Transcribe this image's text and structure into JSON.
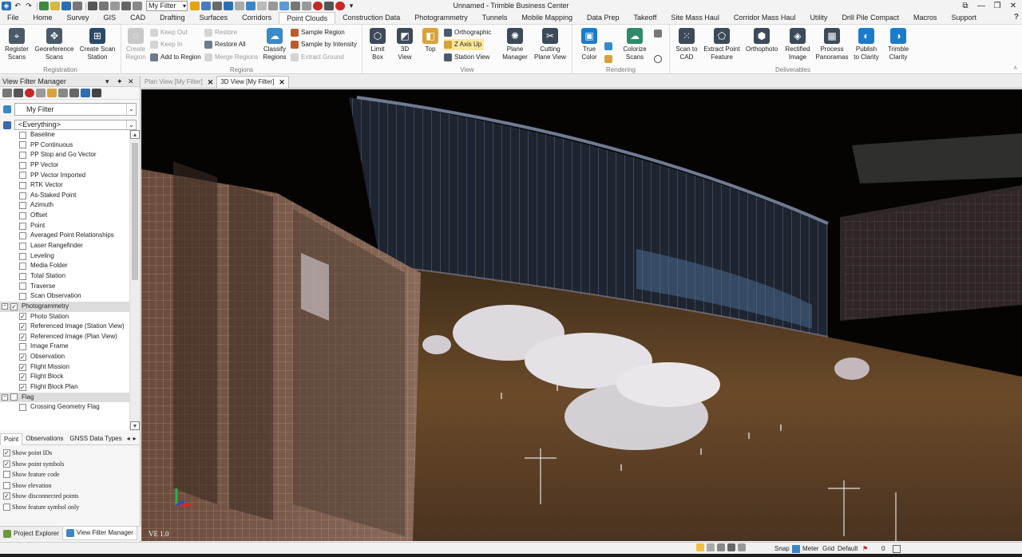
{
  "app": {
    "title": "Unnamed - Trimble Business Center",
    "filter_combo": "My Filter"
  },
  "window_controls": {
    "minimize": "—",
    "restore": "❐",
    "close": "✕",
    "pin": "⧉",
    "help": "?"
  },
  "menu": {
    "tabs": [
      "File",
      "Home",
      "Survey",
      "GIS",
      "CAD",
      "Drafting",
      "Surfaces",
      "Corridors",
      "Point Clouds",
      "Construction Data",
      "Photogrammetry",
      "Tunnels",
      "Mobile Mapping",
      "Data Prep",
      "Takeoff",
      "Site Mass Haul",
      "Corridor Mass Haul",
      "Utility",
      "Drill Pile Compact",
      "Macros",
      "Support"
    ],
    "active": "Point Clouds"
  },
  "ribbon": {
    "registration": {
      "label": "Registration",
      "register": "Register\nScans",
      "georeference": "Georeference\nScans",
      "create_scan_station": "Create Scan\nStation"
    },
    "regions": {
      "label": "Regions",
      "create_region": "Create\nRegion",
      "keep_out": "Keep Out",
      "keep_in": "Keep In",
      "add_to_region": "Add to Region",
      "restore": "Restore",
      "restore_all": "Restore All",
      "merge_regions": "Merge Regions",
      "classify_regions": "Classify\nRegions",
      "sample_region": "Sample Region",
      "sample_by_intensity": "Sample by Intensity",
      "extract_ground": "Extract Ground"
    },
    "view": {
      "label": "View",
      "limit_box": "Limit\nBox",
      "view_3d": "3D\nView",
      "top": "Top",
      "orthographic": "Orthographic",
      "z_axis_up": "Z Axis Up",
      "station_view": "Station View",
      "plane_manager": "Plane\nManager",
      "cutting_plane_view": "Cutting\nPlane View"
    },
    "rendering": {
      "label": "Rendering",
      "true_color": "True\nColor",
      "colorize_scans": "Colorize\nScans"
    },
    "deliverables": {
      "label": "Deliverables",
      "scan_to_cad": "Scan to\nCAD",
      "extract_point_feature": "Extract Point\nFeature",
      "orthophoto": "Orthophoto",
      "rectified_image": "Rectified\nImage",
      "process_panoramas": "Process\nPanoramas",
      "publish_to_clarity": "Publish\nto Clarity",
      "trimble_clarity": "Trimble\nClarity"
    }
  },
  "panel": {
    "title": "View Filter Manager",
    "pin_glyph": "▾ ✦ ✕",
    "filter_value": "My Filter",
    "scope_value": "<Everything>",
    "tree": [
      {
        "label": "Baseline",
        "checked": false,
        "type": "item"
      },
      {
        "label": "PP Continuous",
        "checked": false,
        "type": "item"
      },
      {
        "label": "PP Stop and Go Vector",
        "checked": false,
        "type": "item"
      },
      {
        "label": "PP Vector",
        "checked": false,
        "type": "item"
      },
      {
        "label": "PP Vector Imported",
        "checked": false,
        "type": "item"
      },
      {
        "label": "RTK Vector",
        "checked": false,
        "type": "item"
      },
      {
        "label": "As-Staked Point",
        "checked": false,
        "type": "item"
      },
      {
        "label": "Azimuth",
        "checked": false,
        "type": "item"
      },
      {
        "label": "Offset",
        "checked": false,
        "type": "item"
      },
      {
        "label": "Point",
        "checked": false,
        "type": "item"
      },
      {
        "label": "Averaged Point Relationships",
        "checked": false,
        "type": "item"
      },
      {
        "label": "Laser Rangefinder",
        "checked": false,
        "type": "item"
      },
      {
        "label": "Leveling",
        "checked": false,
        "type": "item"
      },
      {
        "label": "Media Folder",
        "checked": false,
        "type": "item"
      },
      {
        "label": "Total Station",
        "checked": false,
        "type": "item"
      },
      {
        "label": "Traverse",
        "checked": false,
        "type": "item"
      },
      {
        "label": "Scan Observation",
        "checked": false,
        "type": "item"
      },
      {
        "label": "Photogrammetry",
        "checked": true,
        "type": "group"
      },
      {
        "label": "Photo Station",
        "checked": true,
        "type": "item"
      },
      {
        "label": "Referenced Image (Station View)",
        "checked": true,
        "type": "item"
      },
      {
        "label": "Referenced Image (Plan View)",
        "checked": true,
        "type": "item"
      },
      {
        "label": "Image Frame",
        "checked": false,
        "type": "item"
      },
      {
        "label": "Observation",
        "checked": true,
        "type": "item"
      },
      {
        "label": "Flight Mission",
        "checked": true,
        "type": "item"
      },
      {
        "label": "Flight Block",
        "checked": true,
        "type": "item"
      },
      {
        "label": "Flight Block Plan",
        "checked": true,
        "type": "item"
      },
      {
        "label": "Flag",
        "checked": false,
        "type": "group"
      },
      {
        "label": "Crossing Geometry Flag",
        "checked": false,
        "type": "item"
      }
    ],
    "tabs": [
      "Point",
      "Observations",
      "GNSS Data Types"
    ],
    "options": [
      {
        "label": "Show point IDs",
        "checked": true
      },
      {
        "label": "Show point symbols",
        "checked": true
      },
      {
        "label": "Show feature code",
        "checked": false
      },
      {
        "label": "Show elevation",
        "checked": false
      },
      {
        "label": "Show disconnected points",
        "checked": true
      },
      {
        "label": "Show feature symbol only",
        "checked": false
      }
    ],
    "bottom_tabs": [
      "Project Explorer",
      "View Filter Manager"
    ]
  },
  "doc_tabs": [
    "Plan View [My Filter]",
    "3D View [My Filter]"
  ],
  "active_doc_tab": "3D View [My Filter]",
  "view": {
    "label": "VE 1.0"
  },
  "status": {
    "snap": "Snap",
    "units": "Meter",
    "grid": "Grid",
    "layer": "Default",
    "count": "0"
  },
  "colors": {
    "accent": "#1a7cc9",
    "ribbon_bg": "#fbfbfb",
    "viewport_bg": "#050403",
    "ground": "#6b4a2a"
  }
}
